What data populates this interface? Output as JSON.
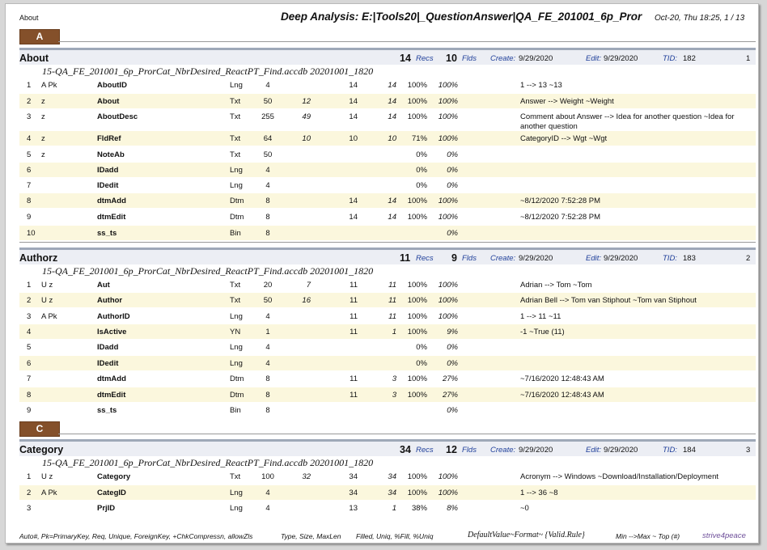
{
  "header": {
    "left": "About",
    "title": "Deep Analysis: E:|Tools20|_QuestionAnswer|QA_FE_201001_6p_Pror",
    "date": "Oct-20, Thu 18:25,  1 / 13"
  },
  "labels": {
    "recs": "Recs",
    "flds": "Flds",
    "create": "Create:",
    "edit": "Edit:",
    "tid": "TID:"
  },
  "sections": [
    {
      "letter": "A"
    },
    {
      "letter": "C"
    }
  ],
  "tables": [
    {
      "name": "About",
      "recs": "14",
      "flds": "10",
      "create": "9/29/2020",
      "edit": "9/29/2020",
      "tid": "182",
      "page": "1",
      "db": "15-QA_FE_201001_6p_ProrCat_NbrDesired_ReactPT_Find.accdb 20201001_1820",
      "rows": [
        {
          "n": "1",
          "flag": "A Pk",
          "name": "AboutID",
          "type": "Lng",
          "size": "4",
          "max": "",
          "fill": "14",
          "uniq": "14",
          "pct": "100%",
          "pctu": "100%",
          "desc": "1 --> 13 ~13"
        },
        {
          "n": "2",
          "flag": "z",
          "name": "About",
          "type": "Txt",
          "size": "50",
          "max": "12",
          "fill": "14",
          "uniq": "14",
          "pct": "100%",
          "pctu": "100%",
          "desc": "Answer --> Weight ~Weight"
        },
        {
          "n": "3",
          "flag": "z",
          "name": "AboutDesc",
          "type": "Txt",
          "size": "255",
          "max": "49",
          "fill": "14",
          "uniq": "14",
          "pct": "100%",
          "pctu": "100%",
          "desc": "Comment about Answer --> Idea for another question ~Idea for another question"
        },
        {
          "n": "4",
          "flag": "z",
          "name": "FldRef",
          "type": "Txt",
          "size": "64",
          "max": "10",
          "fill": "10",
          "uniq": "10",
          "pct": "71%",
          "pctu": "100%",
          "desc": "CategoryID --> Wgt ~Wgt"
        },
        {
          "n": "5",
          "flag": "z",
          "name": "NoteAb",
          "type": "Txt",
          "size": "50",
          "max": "",
          "fill": "",
          "uniq": "",
          "pct": "0%",
          "pctu": "0%",
          "desc": ""
        },
        {
          "n": "6",
          "flag": "",
          "name": "IDadd",
          "type": "Lng",
          "size": "4",
          "max": "",
          "fill": "",
          "uniq": "",
          "pct": "0%",
          "pctu": "0%",
          "desc": ""
        },
        {
          "n": "7",
          "flag": "",
          "name": "IDedit",
          "type": "Lng",
          "size": "4",
          "max": "",
          "fill": "",
          "uniq": "",
          "pct": "0%",
          "pctu": "0%",
          "desc": ""
        },
        {
          "n": "8",
          "flag": "",
          "name": "dtmAdd",
          "type": "Dtm",
          "size": "8",
          "max": "",
          "fill": "14",
          "uniq": "14",
          "pct": "100%",
          "pctu": "100%",
          "desc": " ~8/12/2020 7:52:28 PM"
        },
        {
          "n": "9",
          "flag": "",
          "name": "dtmEdit",
          "type": "Dtm",
          "size": "8",
          "max": "",
          "fill": "14",
          "uniq": "14",
          "pct": "100%",
          "pctu": "100%",
          "desc": " ~8/12/2020 7:52:28 PM"
        },
        {
          "n": "10",
          "flag": "",
          "name": "ss_ts",
          "type": "Bin",
          "size": "8",
          "max": "",
          "fill": "",
          "uniq": "",
          "pct": "",
          "pctu": "0%",
          "desc": ""
        }
      ]
    },
    {
      "name": "Authorz",
      "recs": "11",
      "flds": "9",
      "create": "9/29/2020",
      "edit": "9/29/2020",
      "tid": "183",
      "page": "2",
      "db": "15-QA_FE_201001_6p_ProrCat_NbrDesired_ReactPT_Find.accdb 20201001_1820",
      "rows": [
        {
          "n": "1",
          "flag": "U z",
          "name": "Aut",
          "type": "Txt",
          "size": "20",
          "max": "7",
          "fill": "11",
          "uniq": "11",
          "pct": "100%",
          "pctu": "100%",
          "desc": "Adrian --> Tom ~Tom"
        },
        {
          "n": "2",
          "flag": "U z",
          "name": "Author",
          "type": "Txt",
          "size": "50",
          "max": "16",
          "fill": "11",
          "uniq": "11",
          "pct": "100%",
          "pctu": "100%",
          "desc": "Adrian Bell --> Tom van Stiphout ~Tom van Stiphout"
        },
        {
          "n": "3",
          "flag": "A Pk",
          "name": "AuthorID",
          "type": "Lng",
          "size": "4",
          "max": "",
          "fill": "11",
          "uniq": "11",
          "pct": "100%",
          "pctu": "100%",
          "desc": "1 --> 11 ~11"
        },
        {
          "n": "4",
          "flag": "",
          "name": "IsActive",
          "type": "YN",
          "size": "1",
          "max": "",
          "fill": "11",
          "uniq": "1",
          "pct": "100%",
          "pctu": "9%",
          "desc": "-1 ~True (11)"
        },
        {
          "n": "5",
          "flag": "",
          "name": "IDadd",
          "type": "Lng",
          "size": "4",
          "max": "",
          "fill": "",
          "uniq": "",
          "pct": "0%",
          "pctu": "0%",
          "desc": ""
        },
        {
          "n": "6",
          "flag": "",
          "name": "IDedit",
          "type": "Lng",
          "size": "4",
          "max": "",
          "fill": "",
          "uniq": "",
          "pct": "0%",
          "pctu": "0%",
          "desc": ""
        },
        {
          "n": "7",
          "flag": "",
          "name": "dtmAdd",
          "type": "Dtm",
          "size": "8",
          "max": "",
          "fill": "11",
          "uniq": "3",
          "pct": "100%",
          "pctu": "27%",
          "desc": " ~7/16/2020 12:48:43 AM"
        },
        {
          "n": "8",
          "flag": "",
          "name": "dtmEdit",
          "type": "Dtm",
          "size": "8",
          "max": "",
          "fill": "11",
          "uniq": "3",
          "pct": "100%",
          "pctu": "27%",
          "desc": " ~7/16/2020 12:48:43 AM"
        },
        {
          "n": "9",
          "flag": "",
          "name": "ss_ts",
          "type": "Bin",
          "size": "8",
          "max": "",
          "fill": "",
          "uniq": "",
          "pct": "",
          "pctu": "0%",
          "desc": ""
        }
      ]
    },
    {
      "name": "Category",
      "recs": "34",
      "flds": "12",
      "create": "9/29/2020",
      "edit": "9/29/2020",
      "tid": "184",
      "page": "3",
      "db": "15-QA_FE_201001_6p_ProrCat_NbrDesired_ReactPT_Find.accdb 20201001_1820",
      "rows": [
        {
          "n": "1",
          "flag": "U z",
          "name": "Category",
          "type": "Txt",
          "size": "100",
          "max": "32",
          "fill": "34",
          "uniq": "34",
          "pct": "100%",
          "pctu": "100%",
          "desc": "Acronym --> Windows ~Download/Installation/Deployment"
        },
        {
          "n": "2",
          "flag": "A Pk",
          "name": "CategID",
          "type": "Lng",
          "size": "4",
          "max": "",
          "fill": "34",
          "uniq": "34",
          "pct": "100%",
          "pctu": "100%",
          "desc": "1 --> 36 ~8"
        },
        {
          "n": "3",
          "flag": "",
          "name": "PrjID",
          "type": "Lng",
          "size": "4",
          "max": "",
          "fill": "13",
          "uniq": "1",
          "pct": "38%",
          "pctu": "8%",
          "desc": " ~0"
        }
      ]
    }
  ],
  "footer": {
    "legend": "Auto#, Pk=PrimaryKey, Req, Unique, ForeignKey, +ChkCompressn, allowZls",
    "type": "Type, Size, MaxLen",
    "filled": "Filled, Uniq, %Fill, %Uniq",
    "default": "DefaultValue~Format~ {Valid.Rule}",
    "minmax": "Min -->Max  ~ Top (#)",
    "brand": "strive4peace"
  }
}
